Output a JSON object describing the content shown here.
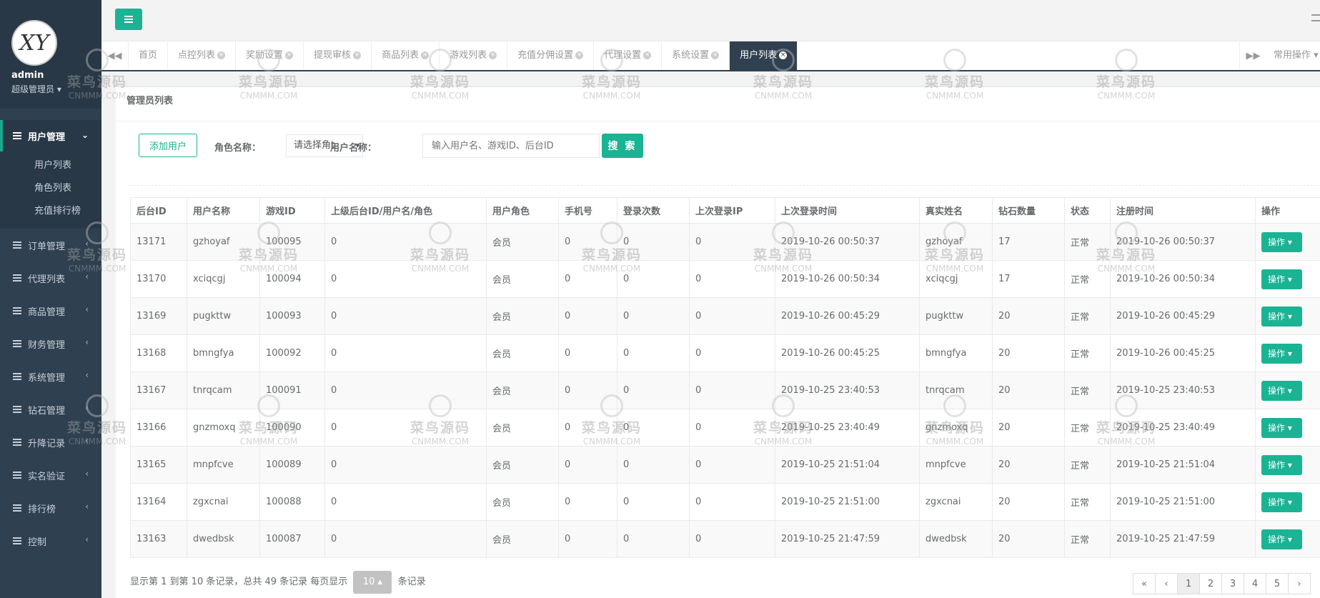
{
  "user": {
    "name": "admin",
    "role": "超级管理员",
    "avatar_text": "XY"
  },
  "sidebar": {
    "active": {
      "label": "用户管理",
      "arrow": "⌄"
    },
    "subitems": [
      "用户列表",
      "角色列表",
      "充值排行榜"
    ],
    "items": [
      {
        "label": "订单管理",
        "arrow": "‹"
      },
      {
        "label": "代理列表",
        "arrow": "‹"
      },
      {
        "label": "商品管理",
        "arrow": "‹"
      },
      {
        "label": "财务管理",
        "arrow": "‹"
      },
      {
        "label": "系统管理",
        "arrow": "‹"
      },
      {
        "label": "钻石管理",
        "arrow": "‹"
      },
      {
        "label": "升降记录",
        "arrow": "‹"
      },
      {
        "label": "实名验证",
        "arrow": "‹"
      },
      {
        "label": "排行榜",
        "arrow": "‹"
      },
      {
        "label": "控制",
        "arrow": "‹"
      }
    ]
  },
  "tabs": {
    "prev": "◀◀",
    "next": "▶▶",
    "ops": "常用操作",
    "items": [
      {
        "label": "首页",
        "closable": false
      },
      {
        "label": "点控列表",
        "closable": true
      },
      {
        "label": "奖励设置",
        "closable": true
      },
      {
        "label": "提现审核",
        "closable": true
      },
      {
        "label": "商品列表",
        "closable": true
      },
      {
        "label": "游戏列表",
        "closable": true
      },
      {
        "label": "充值分佣设置",
        "closable": true
      },
      {
        "label": "代理设置",
        "closable": true
      },
      {
        "label": "系统设置",
        "closable": true
      },
      {
        "label": "用户列表",
        "closable": true,
        "active": true
      }
    ]
  },
  "panel": {
    "title": "管理员列表",
    "add_button": "添加用户",
    "role_label": "角色名称：",
    "role_select": "请选择角t",
    "user_label": "用户名称：",
    "search_placeholder": "输入用户名、游戏ID、后台ID",
    "search_button": "搜 索"
  },
  "table": {
    "columns": [
      "后台ID",
      "用户名称",
      "游戏ID",
      "上级后台ID/用户名/角色",
      "用户角色",
      "手机号",
      "登录次数",
      "上次登录IP",
      "上次登录时间",
      "真实姓名",
      "钻石数量",
      "状态",
      "注册时间",
      "操作"
    ],
    "op_label": "操作 ▾",
    "rows": [
      [
        "13171",
        "gzhoyaf",
        "100095",
        "0",
        "会员",
        "0",
        "0",
        "0",
        "2019-10-26 00:50:37",
        "gzhoyaf",
        "17",
        "正常",
        "2019-10-26 00:50:37"
      ],
      [
        "13170",
        "xciqcgj",
        "100094",
        "0",
        "会员",
        "0",
        "0",
        "0",
        "2019-10-26 00:50:34",
        "xciqcgj",
        "17",
        "正常",
        "2019-10-26 00:50:34"
      ],
      [
        "13169",
        "pugkttw",
        "100093",
        "0",
        "会员",
        "0",
        "0",
        "0",
        "2019-10-26 00:45:29",
        "pugkttw",
        "20",
        "正常",
        "2019-10-26 00:45:29"
      ],
      [
        "13168",
        "bmngfya",
        "100092",
        "0",
        "会员",
        "0",
        "0",
        "0",
        "2019-10-26 00:45:25",
        "bmngfya",
        "20",
        "正常",
        "2019-10-26 00:45:25"
      ],
      [
        "13167",
        "tnrqcam",
        "100091",
        "0",
        "会员",
        "0",
        "0",
        "0",
        "2019-10-25 23:40:53",
        "tnrqcam",
        "20",
        "正常",
        "2019-10-25 23:40:53"
      ],
      [
        "13166",
        "gnzmoxq",
        "100090",
        "0",
        "会员",
        "0",
        "0",
        "0",
        "2019-10-25 23:40:49",
        "gnzmoxq",
        "20",
        "正常",
        "2019-10-25 23:40:49"
      ],
      [
        "13165",
        "mnpfcve",
        "100089",
        "0",
        "会员",
        "0",
        "0",
        "0",
        "2019-10-25 21:51:04",
        "mnpfcve",
        "20",
        "正常",
        "2019-10-25 21:51:04"
      ],
      [
        "13164",
        "zgxcnai",
        "100088",
        "0",
        "会员",
        "0",
        "0",
        "0",
        "2019-10-25 21:51:00",
        "zgxcnai",
        "20",
        "正常",
        "2019-10-25 21:51:00"
      ],
      [
        "13163",
        "dwedbsk",
        "100087",
        "0",
        "会员",
        "0",
        "0",
        "0",
        "2019-10-25 21:47:59",
        "dwedbsk",
        "20",
        "正常",
        "2019-10-25 21:47:59"
      ]
    ]
  },
  "footer": {
    "info_prefix": "显示第 1 到第 10 条记录，总共 49 条记录 每页显示",
    "page_size": "10 ▴",
    "info_suffix": "条记录",
    "pages": [
      "«",
      "‹",
      "1",
      "2",
      "3",
      "4",
      "5",
      "›"
    ]
  },
  "watermark": {
    "cn": "菜鸟源码",
    "en": "CNMMM.COM"
  },
  "colors": {
    "accent": "#1ab394",
    "sidebar": "#2f4050"
  }
}
